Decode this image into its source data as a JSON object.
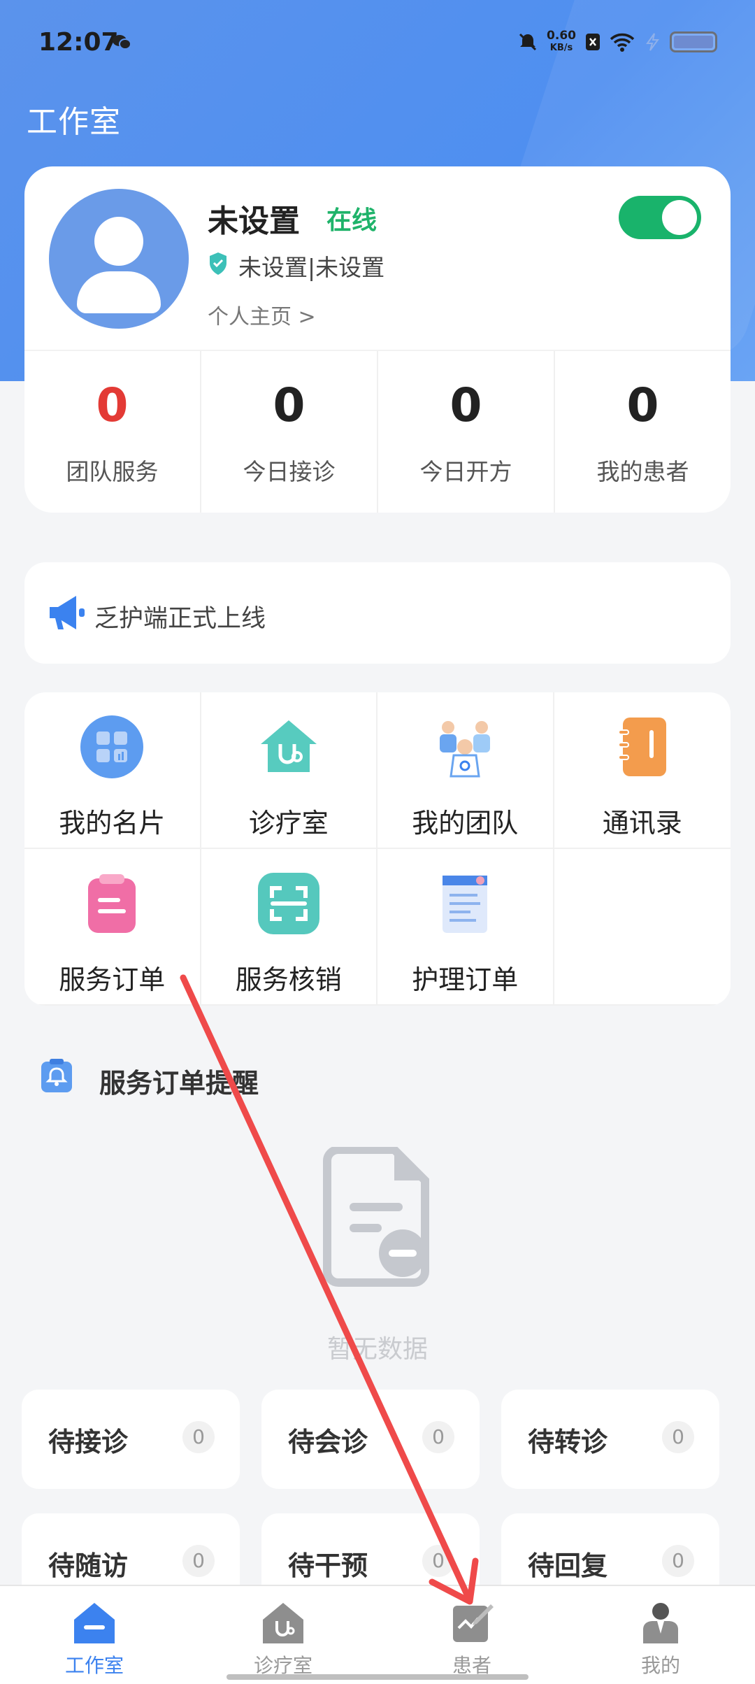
{
  "status_bar": {
    "time": "12:07",
    "speed_value": "0.60",
    "speed_unit": "KB/s"
  },
  "header": {
    "title": "工作室"
  },
  "profile": {
    "name": "未设置",
    "status": "在线",
    "title": "未设置|未设置",
    "home_link": "个人主页 >",
    "online_toggle": true
  },
  "stats": [
    {
      "value": "0",
      "label": "团队服务",
      "color": "#e33a35"
    },
    {
      "value": "0",
      "label": "今日接诊"
    },
    {
      "value": "0",
      "label": "今日开方"
    },
    {
      "value": "0",
      "label": "我的患者"
    }
  ],
  "notice": {
    "text": "乏护端正式上线"
  },
  "grid": [
    {
      "label": "我的名片",
      "icon": "business-card-icon"
    },
    {
      "label": "诊疗室",
      "icon": "clinic-icon"
    },
    {
      "label": "我的团队",
      "icon": "team-icon"
    },
    {
      "label": "通讯录",
      "icon": "contacts-icon"
    },
    {
      "label": "服务订单",
      "icon": "service-order-icon"
    },
    {
      "label": "服务核销",
      "icon": "scan-verify-icon"
    },
    {
      "label": "护理订单",
      "icon": "nursing-order-icon"
    }
  ],
  "reminders": {
    "title": "服务订单提醒",
    "empty_text": "暂无数据"
  },
  "pending": [
    {
      "label": "待接诊",
      "count": "0"
    },
    {
      "label": "待会诊",
      "count": "0"
    },
    {
      "label": "待转诊",
      "count": "0"
    },
    {
      "label": "待随访",
      "count": "0"
    },
    {
      "label": "待干预",
      "count": "0"
    },
    {
      "label": "待回复",
      "count": "0"
    }
  ],
  "tabbar": [
    {
      "label": "工作室",
      "active": true
    },
    {
      "label": "诊疗室"
    },
    {
      "label": "患者"
    },
    {
      "label": "我的"
    }
  ],
  "colors": {
    "primary": "#3c82ef",
    "online": "#1fb36a",
    "accent_red": "#e33a35",
    "annotation_arrow": "#ef4a4a"
  }
}
